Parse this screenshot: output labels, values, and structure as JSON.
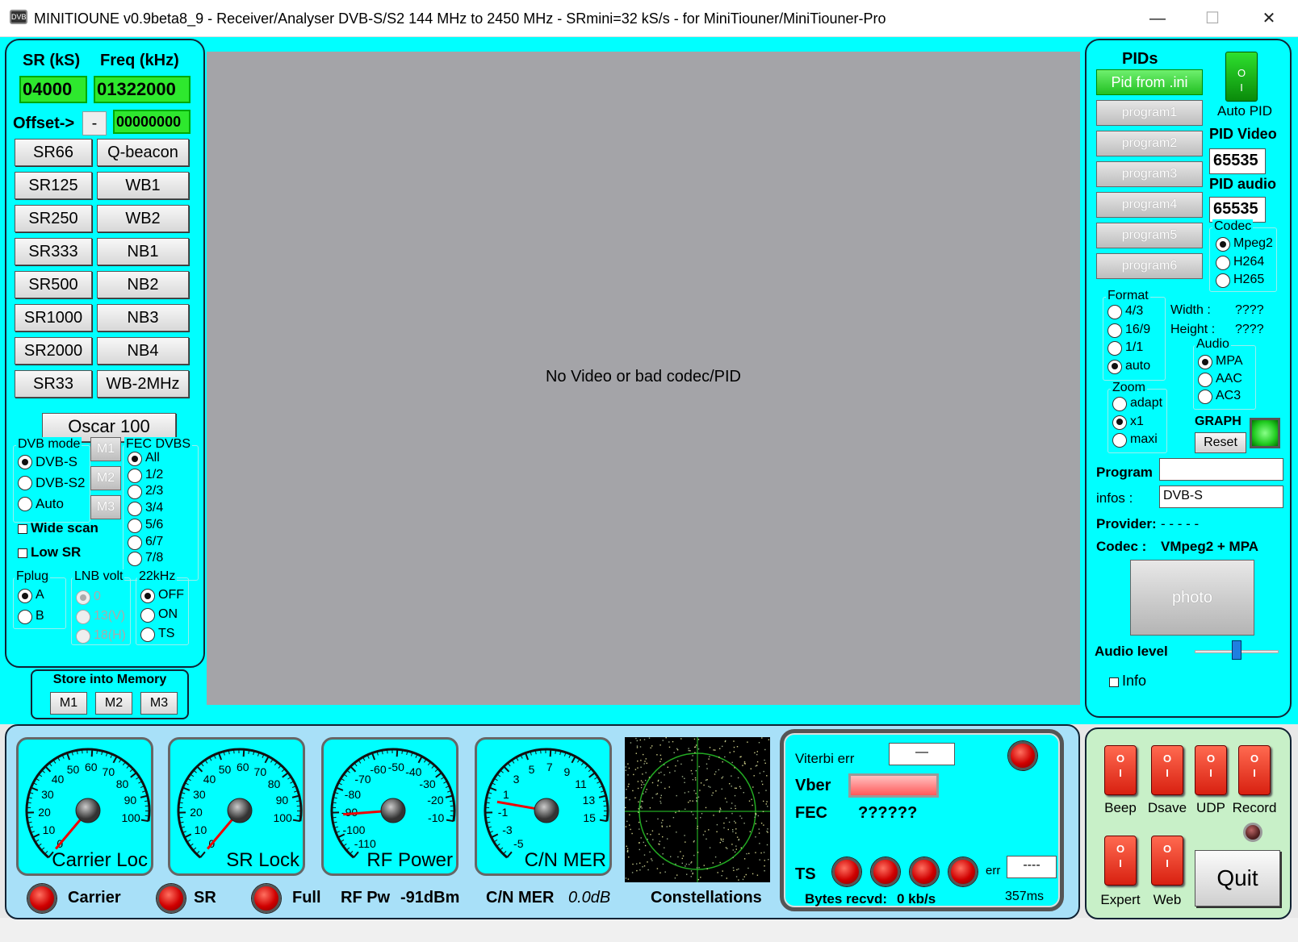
{
  "window": {
    "title": "MINITIOUNE v0.9beta8_9 - Receiver/Analyser DVB-S/S2 144 MHz to 2450 MHz - SRmini=32 kS/s - for MiniTiouner/MiniTiouner-Pro",
    "minimize": "—",
    "maximize": "☐",
    "close": "✕"
  },
  "left": {
    "sr_label": "SR (kS)",
    "freq_label": "Freq (kHz)",
    "sr_value": "04000",
    "freq_value": "01322000",
    "offset_label": "Offset->",
    "offset_sign": "-",
    "offset_value": "00000000",
    "buttons_left": [
      "SR66",
      "SR125",
      "SR250",
      "SR333",
      "SR500",
      "SR1000",
      "SR2000",
      "SR33"
    ],
    "buttons_right": [
      "Q-beacon",
      "WB1",
      "WB2",
      "NB1",
      "NB2",
      "NB3",
      "NB4",
      "WB-2MHz"
    ],
    "oscar": "Oscar 100",
    "dvb_mode_title": "DVB mode",
    "dvb_modes": [
      "DVB-S",
      "DVB-S2",
      "Auto"
    ],
    "mem_buttons": [
      "M1",
      "M2",
      "M3"
    ],
    "fec_title": "FEC DVBS",
    "fec_options": [
      "All",
      "1/2",
      "2/3",
      "3/4",
      "5/6",
      "6/7",
      "7/8"
    ],
    "wide_scan": "Wide scan",
    "low_sr": "Low SR",
    "fplug_title": "Fplug",
    "fplug_options": [
      "A",
      "B"
    ],
    "lnb_title": "LNB volt",
    "lnb_options": [
      "0",
      "13(V)",
      "18(H)"
    ],
    "khz_title": "22kHz",
    "khz_options": [
      "OFF",
      "ON",
      "TS"
    ],
    "store_title": "Store into Memory",
    "store_buttons": [
      "M1",
      "M2",
      "M3"
    ]
  },
  "video": {
    "message": "No Video or bad codec/PID"
  },
  "right": {
    "pids_title": "PIDs",
    "pid_from_ini": "Pid from .ini",
    "programs": [
      "program1",
      "program2",
      "program3",
      "program4",
      "program5",
      "program6"
    ],
    "auto_pid": "Auto PID",
    "pid_video_label": "PID Video",
    "pid_video": "65535",
    "pid_audio_label": "PID audio",
    "pid_audio": "65535",
    "codec_title": "Codec",
    "codecs": [
      "Mpeg2",
      "H264",
      "H265"
    ],
    "format_title": "Format",
    "formats": [
      "4/3",
      "16/9",
      "1/1",
      "auto"
    ],
    "width_label": "Width :",
    "width_value": "????",
    "height_label": "Height :",
    "height_value": "????",
    "audio_title": "Audio",
    "audio_options": [
      "MPA",
      "AAC",
      "AC3"
    ],
    "zoom_title": "Zoom",
    "zoom_options": [
      "adapt",
      "x1",
      "maxi"
    ],
    "graph_label": "GRAPH",
    "reset": "Reset",
    "program_label": "Program",
    "program_value": "",
    "infos_label": "infos :",
    "infos_value": "DVB-S",
    "provider_label": "Provider:",
    "provider_value": "- - - - -",
    "codec_label": "Codec :",
    "codec_value": "VMpeg2 + MPA",
    "photo": "photo",
    "audio_level_label": "Audio level",
    "audio_level": 0.5,
    "info_label": "Info"
  },
  "gauges": [
    {
      "name": "Carrier Loc",
      "ticks": [
        "0",
        "10",
        "20",
        "30",
        "40",
        "50",
        "60",
        "70",
        "80",
        "90",
        "100"
      ],
      "needle": 0.0
    },
    {
      "name": "SR Lock",
      "ticks": [
        "0",
        "10",
        "20",
        "30",
        "40",
        "50",
        "60",
        "70",
        "80",
        "90",
        "100"
      ],
      "needle": 0.0
    },
    {
      "name": "RF Power",
      "ticks": [
        "-110",
        "-100",
        "-90",
        "-80",
        "-70",
        "-60",
        "-50",
        "-40",
        "-30",
        "-20",
        "-10"
      ],
      "needle": -91
    },
    {
      "name": "C/N MER",
      "ticks": [
        "-5",
        "-3",
        "-1",
        "1",
        "3",
        "5",
        "7",
        "9",
        "11",
        "13",
        "15"
      ],
      "needle": 0.0
    }
  ],
  "status": {
    "carrier": "Carrier",
    "sr": "SR",
    "full": "Full",
    "rf_pw_label": "RF Pw",
    "rf_pw_value": "-91dBm",
    "cn_mer_label": "C/N MER",
    "cn_mer_value": "0.0dB",
    "constellations": "Constellations"
  },
  "decoder": {
    "viterbi_label": "Viterbi err",
    "viterbi_value": "—",
    "vber_label": "Vber",
    "fec_label": "FEC",
    "fec_value": "??????",
    "ts_label": "TS",
    "err_label": "err",
    "err_value": "----",
    "bytes_label": "Bytes recvd:",
    "bytes_value": "0 kb/s",
    "time_value": "357ms"
  },
  "switches": {
    "top": [
      "Beep",
      "Dsave",
      "UDP",
      "Record"
    ],
    "bottom": [
      "Expert",
      "Web"
    ],
    "quit": "Quit"
  }
}
